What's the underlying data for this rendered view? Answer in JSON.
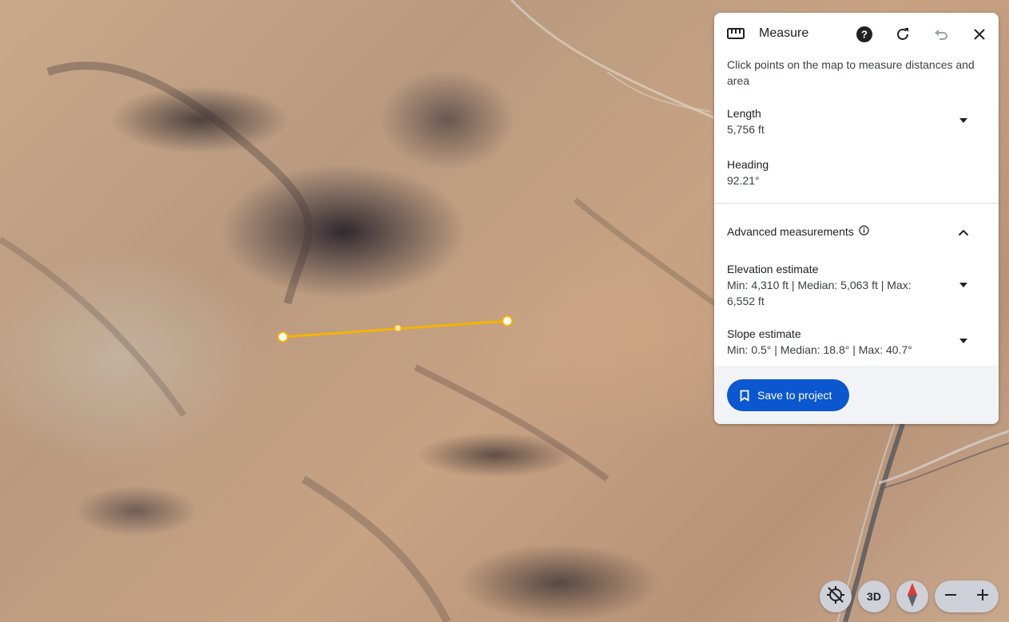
{
  "panel": {
    "title": "Measure",
    "icons": [
      "ruler-icon",
      "help-icon",
      "refresh-icon",
      "undo-icon",
      "close-icon"
    ],
    "description": "Click points on the map to measure distances and area",
    "length": {
      "label": "Length",
      "value": "5,756 ft"
    },
    "heading": {
      "label": "Heading",
      "value": "92.21°"
    },
    "advanced": {
      "title": "Advanced measurements",
      "elevation": {
        "label": "Elevation estimate",
        "value_line1": "Min: 4,310 ft | Median: 5,063 ft | Max:",
        "value_line2": "6,552 ft"
      },
      "slope": {
        "label": "Slope estimate",
        "value": "Min: 0.5° | Median: 18.8° | Max: 40.7°"
      }
    },
    "save_label": "Save to project"
  },
  "controls": {
    "three_d_label": "3D",
    "icons": [
      "no-location-icon",
      "compass-icon",
      "zoom-out-icon",
      "zoom-in-icon"
    ]
  },
  "colors": {
    "accent": "#0b57d0",
    "measure_line": "#f5b400",
    "panel_bg": "#ffffff",
    "footer_bg": "#f1f3f6"
  }
}
